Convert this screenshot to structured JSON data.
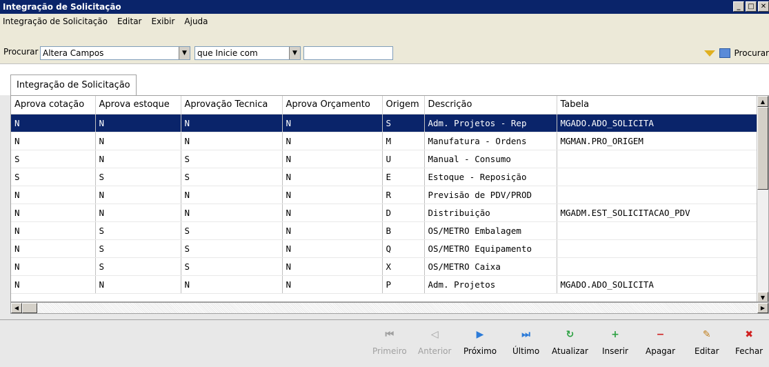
{
  "window": {
    "title": "Integração de Solicitação"
  },
  "menu": [
    "Integração de Solicitação",
    "Editar",
    "Exibir",
    "Ajuda"
  ],
  "search": {
    "label": "Procurar",
    "field_value": "Altera Campos",
    "mode_value": "que Inicie com",
    "text_value": "",
    "button_label": "Procurar"
  },
  "tab": {
    "label": "Integração de Solicitação"
  },
  "grid": {
    "columns": [
      "Aprova cotação",
      "Aprova estoque",
      "Aprovação Tecnica",
      "Aprova Orçamento",
      "Origem",
      "Descrição",
      "Tabela"
    ],
    "rows": [
      [
        "N",
        "N",
        "N",
        "N",
        "S",
        "Adm. Projetos - Rep",
        "MGADO.ADO_SOLICITA"
      ],
      [
        "N",
        "N",
        "N",
        "N",
        "M",
        "Manufatura - Ordens",
        "MGMAN.PRO_ORIGEM"
      ],
      [
        "S",
        "N",
        "S",
        "N",
        "U",
        "Manual - Consumo",
        ""
      ],
      [
        "S",
        "S",
        "S",
        "N",
        "E",
        "Estoque - Reposição",
        ""
      ],
      [
        "N",
        "N",
        "N",
        "N",
        "R",
        "Previsão de PDV/PROD",
        ""
      ],
      [
        "N",
        "N",
        "N",
        "N",
        "D",
        "Distribuição",
        "MGADM.EST_SOLICITACAO_PDV"
      ],
      [
        "N",
        "S",
        "S",
        "N",
        "B",
        "OS/METRO Embalagem",
        ""
      ],
      [
        "N",
        "S",
        "S",
        "N",
        "Q",
        "OS/METRO Equipamento",
        ""
      ],
      [
        "N",
        "S",
        "S",
        "N",
        "X",
        "OS/METRO Caixa",
        ""
      ],
      [
        "N",
        "N",
        "N",
        "N",
        "P",
        "Adm. Projetos",
        "MGADO.ADO_SOLICITA"
      ]
    ],
    "selected_row": 0
  },
  "footer": {
    "first": "Primeiro",
    "prev": "Anterior",
    "next": "Próximo",
    "last": "Último",
    "refresh": "Atualizar",
    "insert": "Inserir",
    "delete": "Apagar",
    "edit": "Editar",
    "close": "Fechar"
  },
  "colors": {
    "titlebar": "#0a246a",
    "selection": "#0a246a",
    "nav_icon": "#2c7bd8",
    "refresh_icon": "#2aa040",
    "close_icon": "#d02020"
  }
}
